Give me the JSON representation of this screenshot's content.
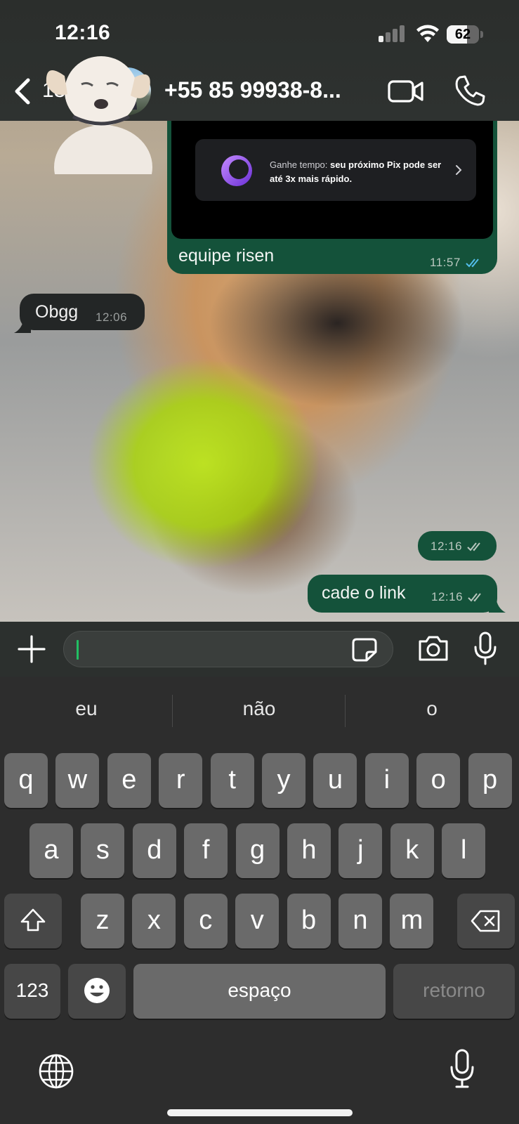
{
  "status_bar": {
    "time": "12:16",
    "battery": "62",
    "battery_level_percent": 62
  },
  "header": {
    "back_count": "132",
    "contact_name": "+55 85 99938-8...",
    "icons": [
      "chevron-left-icon",
      "video-camera-icon",
      "phone-icon"
    ]
  },
  "messages": [
    {
      "direction": "outgoing",
      "type": "image-with-caption",
      "image_text_prefix": "Ganhe tempo:",
      "image_text_bold": "seu próximo Pix pode ser até 3x mais rápido.",
      "caption": "equipe risen",
      "time": "11:57",
      "status": "read"
    },
    {
      "direction": "incoming",
      "type": "text",
      "text": "Obgg",
      "time": "12:06"
    },
    {
      "direction": "outgoing",
      "type": "image",
      "time": "12:16",
      "status": "delivered"
    },
    {
      "direction": "outgoing",
      "type": "text",
      "text": "cade o link",
      "time": "12:16",
      "status": "delivered"
    }
  ],
  "input_bar": {
    "value": "",
    "icons": [
      "plus-icon",
      "sticker-icon",
      "camera-icon",
      "microphone-icon"
    ]
  },
  "keyboard": {
    "suggestions": [
      "eu",
      "não",
      "o"
    ],
    "rows": [
      [
        "q",
        "w",
        "e",
        "r",
        "t",
        "y",
        "u",
        "i",
        "o",
        "p"
      ],
      [
        "a",
        "s",
        "d",
        "f",
        "g",
        "h",
        "j",
        "k",
        "l"
      ],
      [
        "z",
        "x",
        "c",
        "v",
        "b",
        "n",
        "m"
      ]
    ],
    "numbers_label": "123",
    "space_label": "espaço",
    "return_label": "retorno"
  },
  "colors": {
    "outgoing_bubble": "#14523a",
    "incoming_bubble": "#232626",
    "read_tick": "#53bdeb",
    "caret": "#21c063"
  }
}
